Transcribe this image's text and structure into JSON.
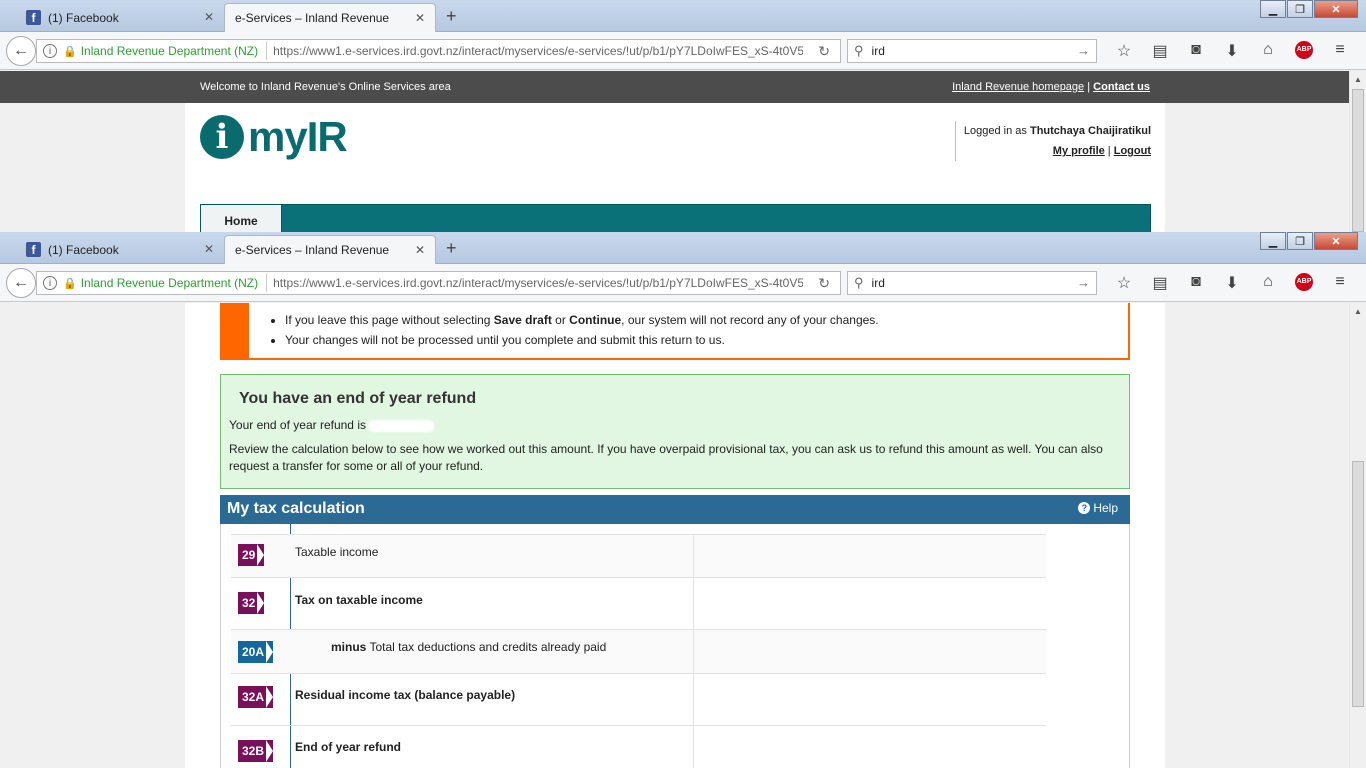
{
  "browser": {
    "tabs": [
      {
        "label": "(1) Facebook"
      },
      {
        "label": "e-Services – Inland Revenue"
      }
    ],
    "site_identity": "Inland Revenue Department (NZ)",
    "url": "https://www1.e-services.ird.govt.nz/interact/myservices/e-services/!ut/p/b1/pY7LDoIwFES_xS-4t0V5",
    "search_value": "ird"
  },
  "topbar": {
    "welcome": "Welcome to Inland Revenue's Online Services area",
    "homepage_link": "Inland Revenue homepage",
    "contact_link": "Contact us"
  },
  "header": {
    "logo_text": "myIR",
    "logged_in_prefix": "Logged in as",
    "user_name": "Thutchaya Chaijiratikul",
    "profile_link": "My profile",
    "logout_link": "Logout"
  },
  "menu": {
    "home": "Home"
  },
  "warning": {
    "items": [
      {
        "pre": "If you leave this page without selecting ",
        "b1": "Save draft",
        "mid": " or ",
        "b2": "Continue",
        "post": ", our system will not record any of your changes."
      },
      {
        "text": "Your changes will not be processed until you complete and submit this return to us."
      }
    ]
  },
  "refund": {
    "title": "You have an end of year refund",
    "line1": "Your end of year refund is",
    "line2": "Review the calculation below to see how we worked out this amount. If you have overpaid provisional tax, you can ask us to refund this amount as well. You can also request a transfer for some or all of your refund."
  },
  "tax": {
    "title": "My tax calculation",
    "help": "Help",
    "rows": [
      {
        "num": "29",
        "label": "Taxable income"
      },
      {
        "num": "32",
        "label": "Tax on taxable income"
      },
      {
        "num": "20A",
        "prefix": "minus",
        "label": " Total tax deductions and credits already paid"
      },
      {
        "num": "32A",
        "label": "Residual income tax (balance payable)"
      },
      {
        "num": "32B",
        "label": "End of year refund"
      }
    ]
  },
  "colors": {
    "teal": "#0a7179",
    "orange": "#ff6600",
    "purple_badge": "#7a0f5b",
    "blue_badge": "#14679a",
    "header_blue": "#2b6a94"
  }
}
